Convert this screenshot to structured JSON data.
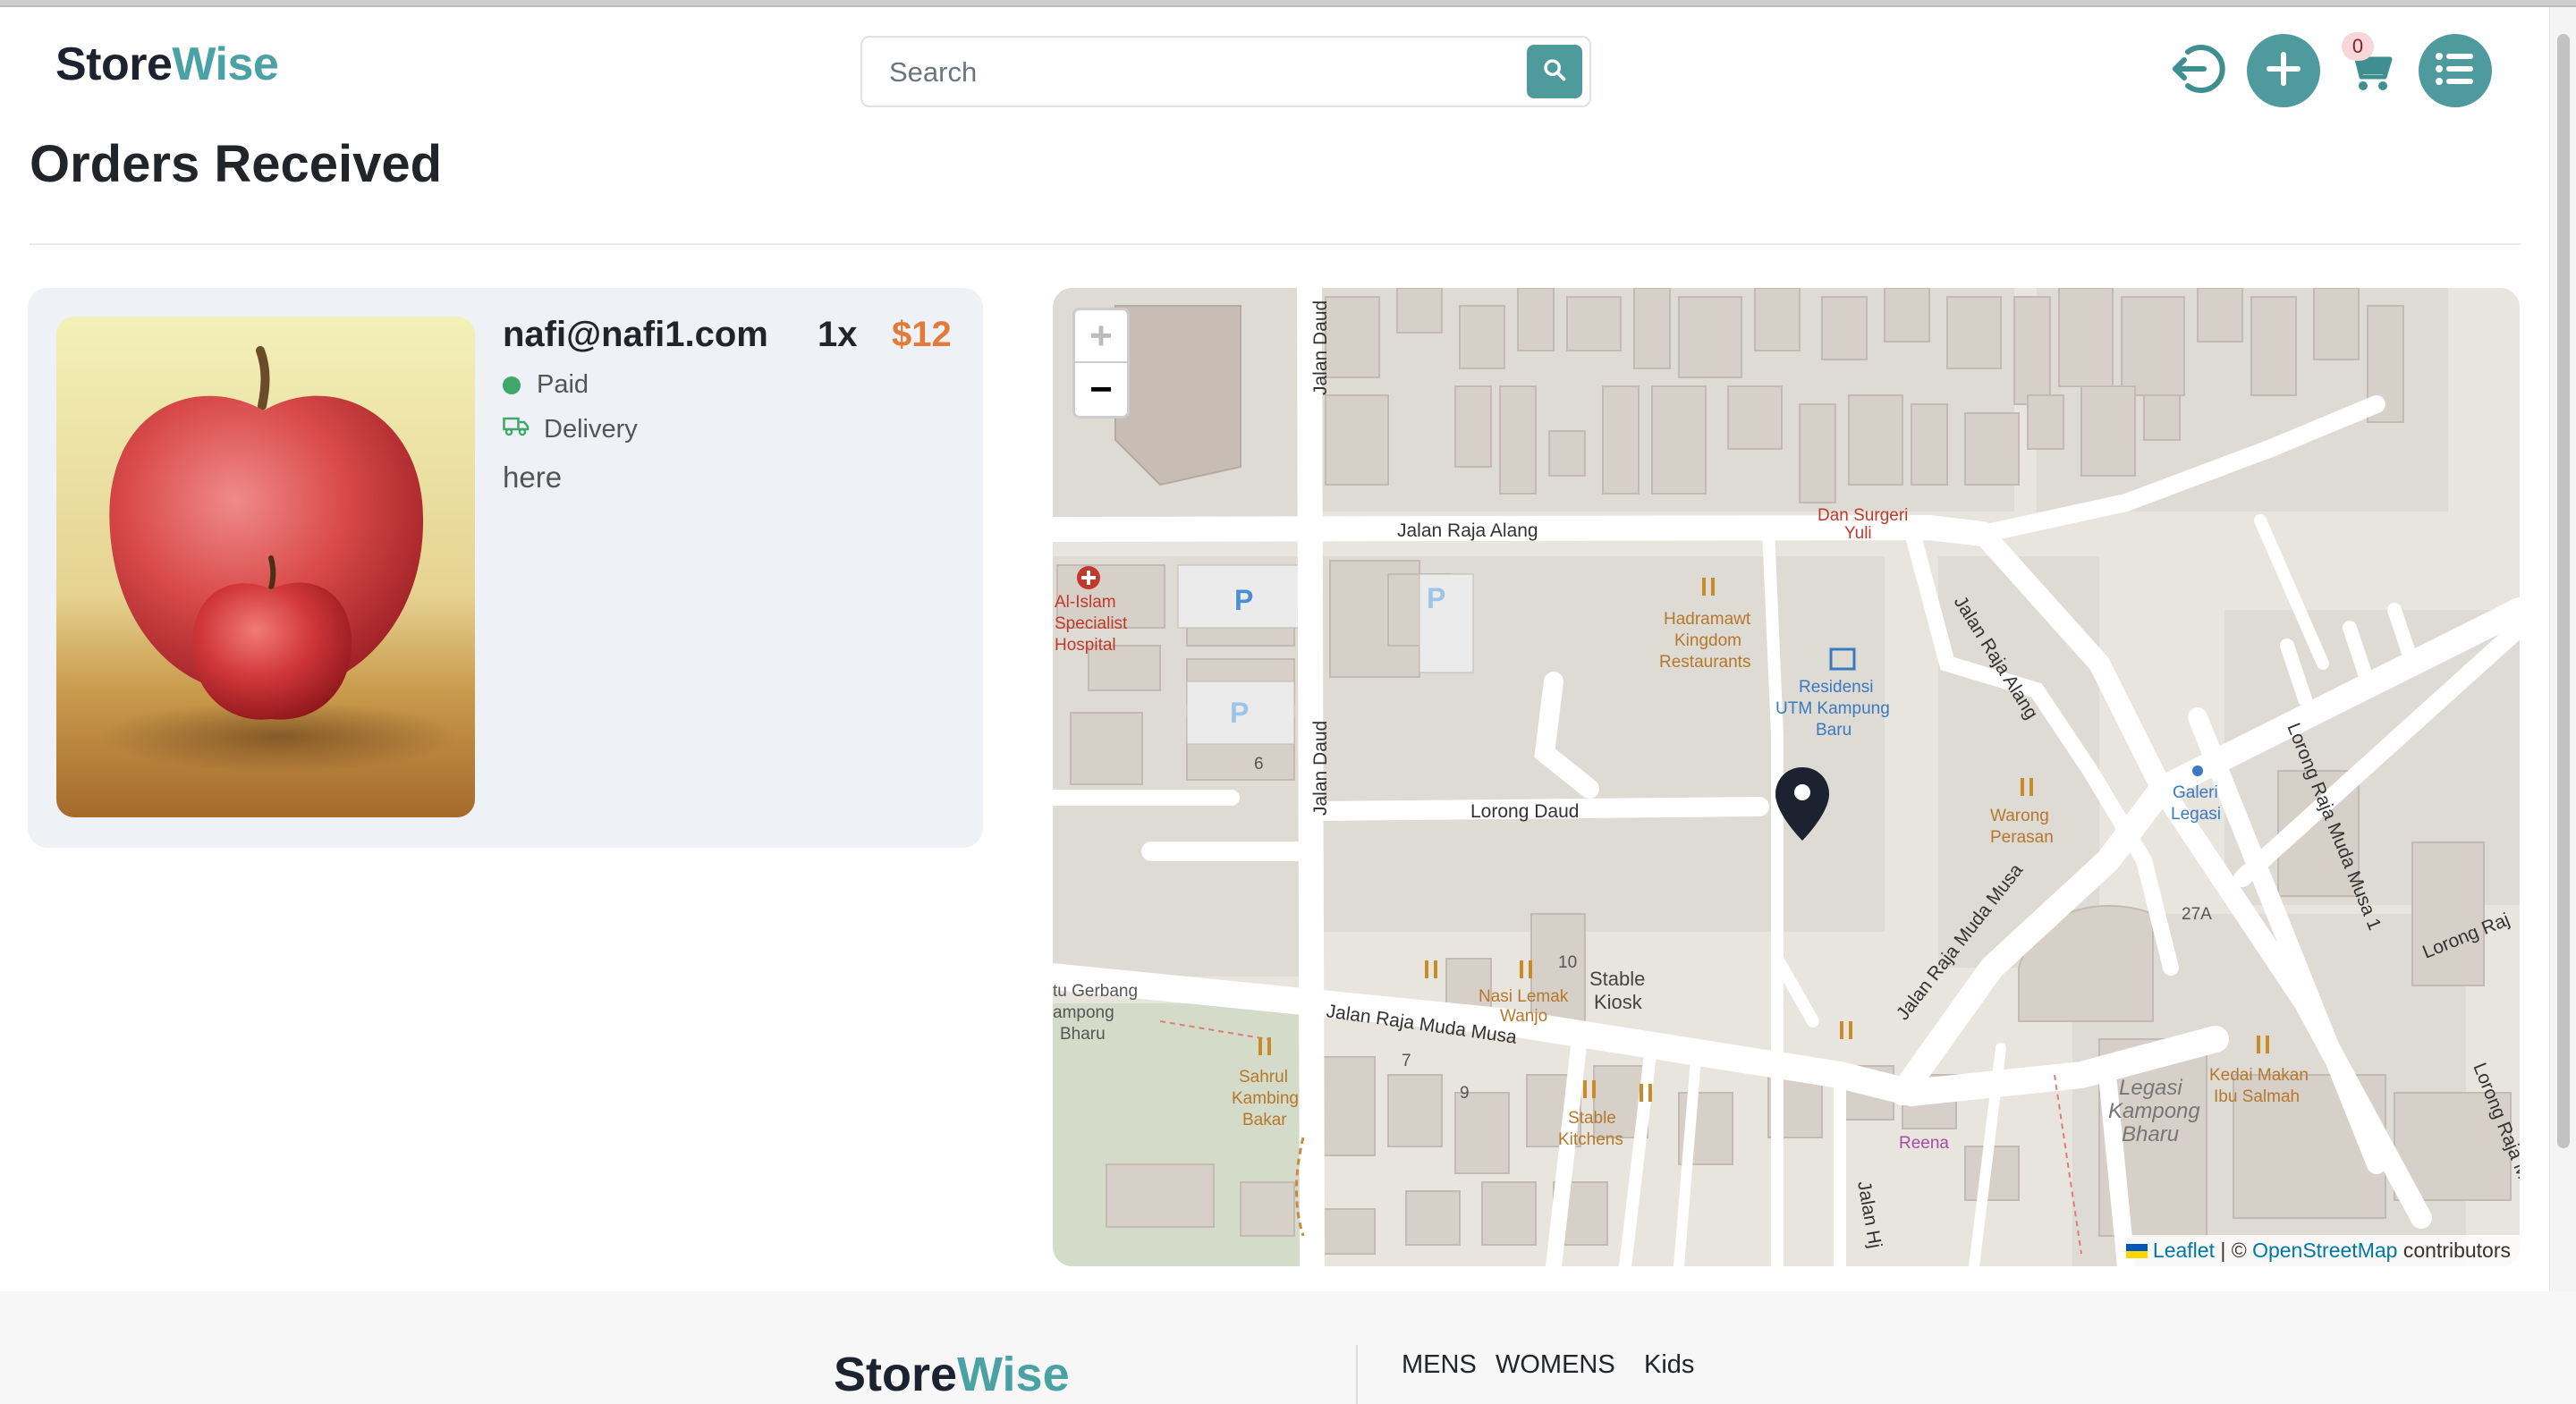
{
  "header": {
    "logo_main": "Store",
    "logo_accent": "Wise",
    "search_placeholder": "Search",
    "cart_count": "0",
    "icons": [
      "logout-icon",
      "plus-icon",
      "cart-icon",
      "list-icon",
      "search-icon"
    ],
    "accent_color": "#4f9a9c"
  },
  "page": {
    "title": "Orders Received"
  },
  "order": {
    "email": "nafi@nafi1.com",
    "quantity": "1x",
    "price": "$12",
    "payment_status": "Paid",
    "fulfillment": "Delivery",
    "address": "here",
    "price_color": "#e07b39",
    "paid_color": "#3fa86a"
  },
  "map": {
    "zoom_in": "+",
    "zoom_out": "−",
    "attribution_leaflet": "Leaflet",
    "attribution_sep": " | © ",
    "attribution_osm": "OpenStreetMap",
    "attribution_tail": " contributors",
    "labels": {
      "jalan_raja_alang": "Jalan Raja Alang",
      "jalan_daud_1": "Jalan Daud",
      "jalan_daud_2": "Jalan Daud",
      "lorong_daud": "Lorong Daud",
      "jalan_raja_alang_diag": "Jalan Raja Alang",
      "jalan_raja_muda_musa": "Jalan Raja Muda Musa",
      "jalan_raja_muda_musa_diag": "Jalan Raja Muda Musa",
      "lorong_raja_muda_musa_1": "Lorong Raja Muda Musa 1",
      "lorong_raja_muda_musa_2": "Lorong Raja Muda",
      "lorong_raj": "Lorong Raj",
      "jalan_hj": "Jalan Hj",
      "dan_surgeri_1": "Dan Surgeri",
      "dan_surgeri_2": "Yuli",
      "hospital_1": "Al-Islam",
      "hospital_2": "Specialist",
      "hospital_3": "Hospital",
      "hadramawt_1": "Hadramawt",
      "hadramawt_2": "Kingdom",
      "hadramawt_3": "Restaurants",
      "residensi_1": "Residensi",
      "residensi_2": "UTM Kampung",
      "residensi_3": "Baru",
      "warong_1": "Warong",
      "warong_2": "Perasan",
      "galeri_1": "Galeri",
      "galeri_2": "Legasi",
      "no_27a": "27A",
      "no_6": "6",
      "no_10": "10",
      "no_7": "7",
      "no_9": "9",
      "stable_kiosk_1": "Stable",
      "stable_kiosk_2": "Kiosk",
      "nasi_1": "Nasi Lemak",
      "nasi_2": "Wanjo",
      "gerbang_1": "tu Gerbang",
      "gerbang_2": "ampong",
      "gerbang_3": "Bharu",
      "sahrul_1": "Sahrul",
      "sahrul_2": "Kambing",
      "sahrul_3": "Bakar",
      "stable_k_1": "Stable",
      "stable_k_2": "Kitchens",
      "reena": "Reena",
      "legasi_1": "Legasi",
      "legasi_2": "Kampong",
      "legasi_3": "Bharu",
      "kedai_1": "Kedai Makan",
      "kedai_2": "Ibu Salmah",
      "parking": "P"
    }
  },
  "footer": {
    "logo_main": "Store",
    "logo_accent": "Wise",
    "links": [
      "MENS",
      "WOMENS",
      "Kids"
    ]
  }
}
